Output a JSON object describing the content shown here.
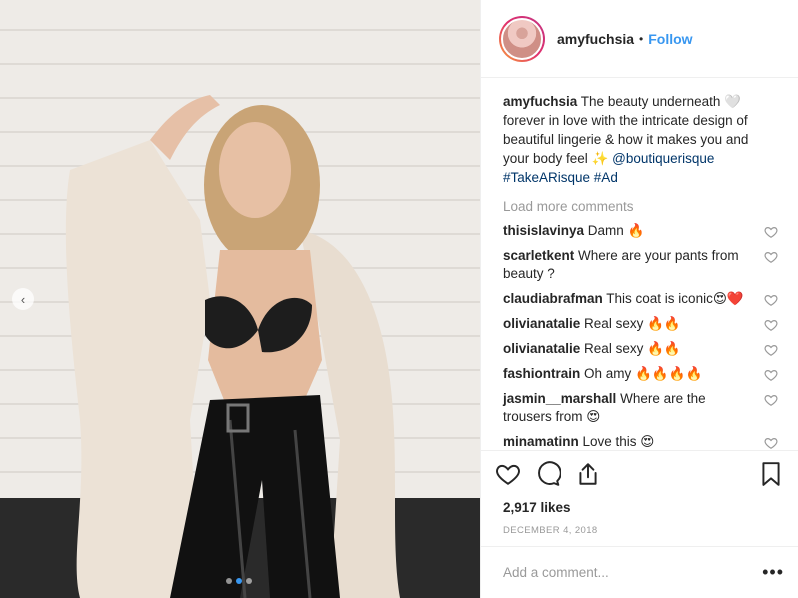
{
  "post": {
    "username": "amyfuchsia",
    "follow_label": "Follow",
    "bullet": "•",
    "caption": {
      "user": "amyfuchsia",
      "text": " The beauty underneath 🤍 forever in love with the intricate design of beautiful lingerie & how it makes you and your body feel ✨ ",
      "mention": "@boutiquerisque",
      "hashtags": "#TakeARisque #Ad"
    },
    "load_more_label": "Load more comments",
    "comments": [
      {
        "user": "thisislavinya",
        "text": " Damn 🔥"
      },
      {
        "user": "scarletkent",
        "text": " Where are your pants from beauty ?"
      },
      {
        "user": "claudiabrafman",
        "text": " This coat is iconic😍❤️"
      },
      {
        "user": "olivianatalie",
        "text": " Real sexy 🔥🔥"
      },
      {
        "user": "olivianatalie",
        "text": " Real sexy 🔥🔥"
      },
      {
        "user": "fashiontrain",
        "text": " Oh amy 🔥🔥🔥🔥"
      },
      {
        "user": "jasmin__marshall",
        "text": " Where are the trousers from 😍"
      },
      {
        "user": "minamatinn",
        "text": " Love this 😍"
      }
    ],
    "likes": "2,917 likes",
    "date": "DECEMBER 4, 2018",
    "add_comment_placeholder": "Add a comment...",
    "more_label": "•••",
    "prev_arrow": "‹"
  },
  "icons": {
    "like": "heart-icon",
    "comment": "comment-icon",
    "share": "share-icon",
    "save": "bookmark-icon"
  },
  "colors": {
    "accent": "#3897f0",
    "text": "#262626",
    "muted": "#999999",
    "border": "#efefef"
  }
}
